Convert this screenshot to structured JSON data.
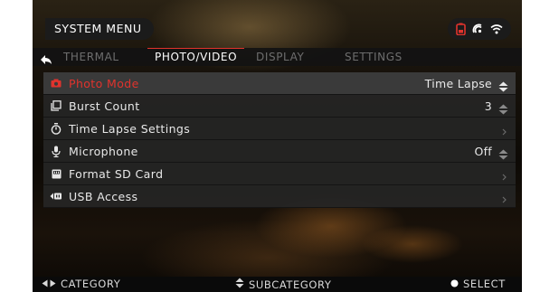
{
  "header": {
    "title": "SYSTEM MENU",
    "status_icons": [
      "battery-icon",
      "thermal-icon",
      "wifi-icon"
    ],
    "battery_color": "#e0332d"
  },
  "tabs": [
    {
      "label": "THERMAL",
      "active": false
    },
    {
      "label": "PHOTO/VIDEO",
      "active": true
    },
    {
      "label": "DISPLAY",
      "active": false
    },
    {
      "label": "SETTINGS",
      "active": false
    }
  ],
  "menu": {
    "items": [
      {
        "label": "Photo Mode",
        "value": "Time Lapse",
        "icon": "camera-icon",
        "selected": true
      },
      {
        "label": "Burst Count",
        "value": "3",
        "icon": "burst-icon",
        "selected": false
      },
      {
        "label": "Time Lapse Settings",
        "value": "",
        "icon": "timer-icon",
        "selected": false
      },
      {
        "label": "Microphone",
        "value": "Off",
        "icon": "microphone-icon",
        "selected": false
      },
      {
        "label": "Format SD Card",
        "value": "",
        "icon": "sd-card-icon",
        "selected": false
      },
      {
        "label": "USB Access",
        "value": "",
        "icon": "usb-icon",
        "selected": false
      }
    ]
  },
  "footer": {
    "category": "CATEGORY",
    "subcategory": "SUBCATEGORY",
    "select": "SELECT"
  },
  "colors": {
    "accent": "#e0332d",
    "panel": "#262626",
    "text": "#e8e8e8"
  }
}
